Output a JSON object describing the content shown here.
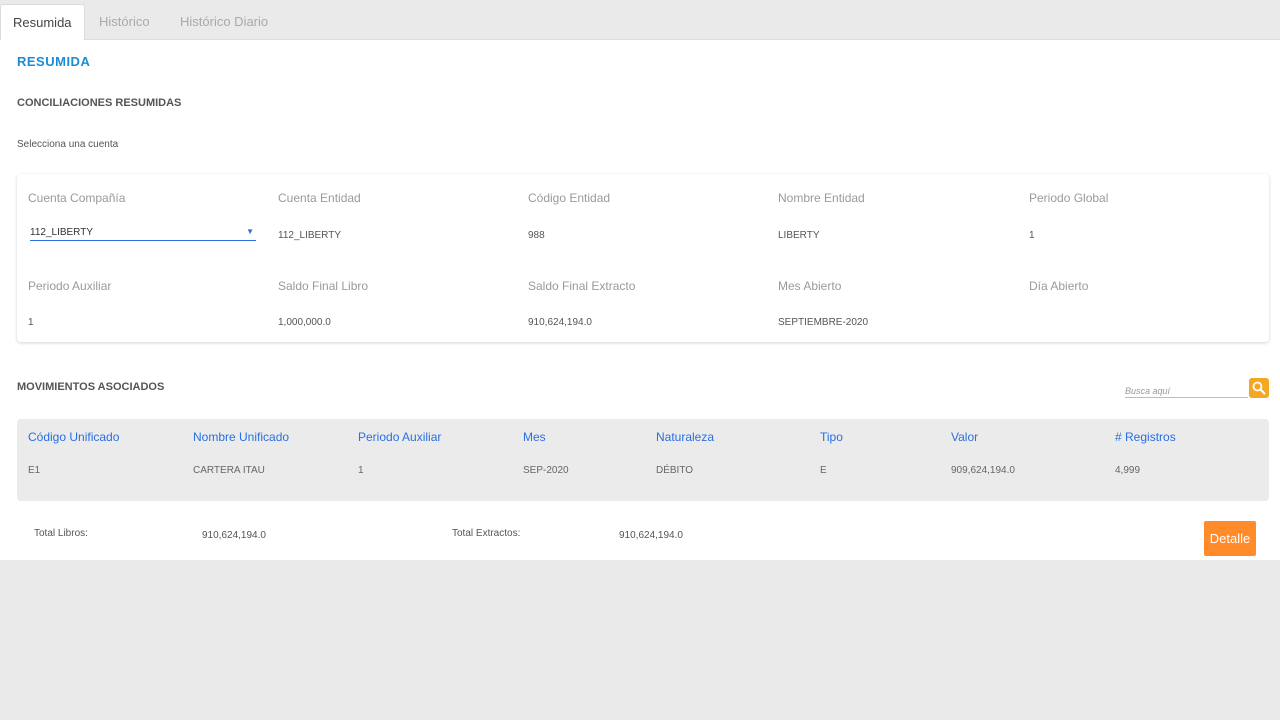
{
  "tabs": [
    {
      "label": "Resumida"
    },
    {
      "label": "Histórico"
    },
    {
      "label": "Histórico Diario"
    }
  ],
  "page_title": "RESUMIDA",
  "section_summary": "CONCILIACIONES RESUMIDAS",
  "hint": "Selecciona una cuenta",
  "summary_fields": {
    "cuenta_compania": {
      "label": "Cuenta Compañía",
      "value": "112_LIBERTY"
    },
    "cuenta_entidad": {
      "label": "Cuenta Entidad",
      "value": "112_LIBERTY"
    },
    "codigo_entidad": {
      "label": "Código Entidad",
      "value": "988"
    },
    "nombre_entidad": {
      "label": "Nombre Entidad",
      "value": "LIBERTY"
    },
    "periodo_global": {
      "label": "Periodo Global",
      "value": "1"
    },
    "periodo_auxiliar": {
      "label": "Periodo Auxiliar",
      "value": "1"
    },
    "saldo_final_libro": {
      "label": "Saldo Final Libro",
      "value": "1,000,000.0"
    },
    "saldo_final_extracto": {
      "label": "Saldo Final Extracto",
      "value": "910,624,194.0"
    },
    "mes_abierto": {
      "label": "Mes Abierto",
      "value": "SEPTIEMBRE-2020"
    },
    "dia_abierto": {
      "label": "Día Abierto",
      "value": ""
    }
  },
  "section_movements": "MOVIMIENTOS ASOCIADOS",
  "search": {
    "placeholder": "Busca aquí"
  },
  "table": {
    "headers": [
      "Código Unificado",
      "Nombre Unificado",
      "Periodo Auxiliar",
      "Mes",
      "Naturaleza",
      "Tipo",
      "Valor",
      "# Registros"
    ],
    "rows": [
      [
        "E1",
        "CARTERA ITAU",
        "1",
        "SEP-2020",
        "DÉBITO",
        "E",
        "909,624,194.0",
        "4,999"
      ]
    ]
  },
  "totals": {
    "libros_label": "Total Libros:",
    "libros_value": "910,624,194.0",
    "extractos_label": "Total Extractos:",
    "extractos_value": "910,624,194.0"
  },
  "detail_button": "Detalle",
  "colors": {
    "accent": "#1a8cd8",
    "header_blue": "#2a6fe0",
    "button_orange": "#ff8b2b",
    "search_orange": "#f5a623"
  }
}
